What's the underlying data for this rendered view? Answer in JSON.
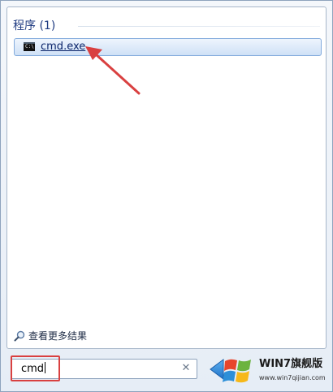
{
  "start_menu": {
    "programs_section": {
      "title": "程序 (1)",
      "results": [
        {
          "label": "cmd.exe",
          "icon": "command-prompt-icon",
          "selected": true
        }
      ]
    },
    "see_more_results": {
      "label": "查看更多结果",
      "icon": "magnifier-icon"
    },
    "search": {
      "value": "cmd",
      "clear_icon": "close-icon"
    },
    "shutdown_icon": "shutdown-arrow-icon"
  },
  "watermark": {
    "brand": "WIN7旗舰版",
    "site": "www.win7qijian.com"
  },
  "colors": {
    "annotation_red": "#d94040",
    "selection_border": "#84acdd",
    "section_title": "#1e3a80"
  }
}
